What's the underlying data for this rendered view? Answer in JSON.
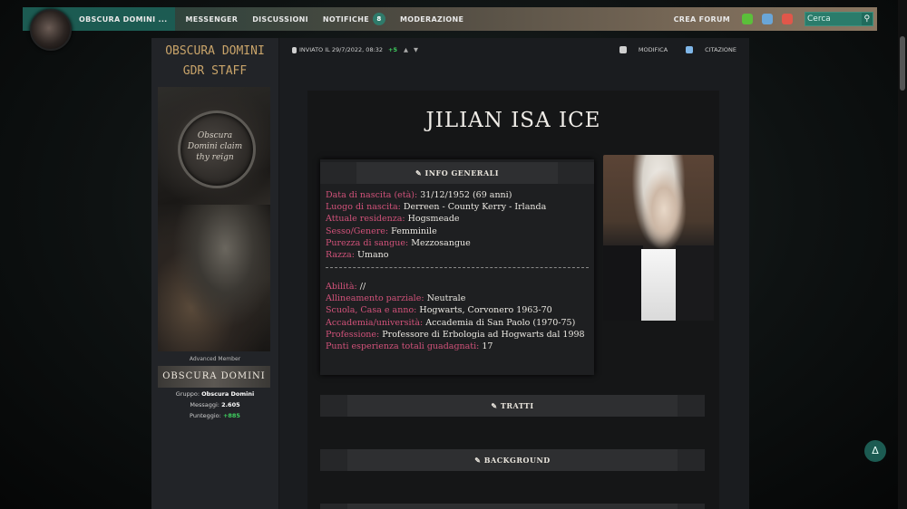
{
  "nav": {
    "brand": "OBSCURA DOMINI ...",
    "items": [
      "MESSENGER",
      "DISCUSSIONI",
      "NOTIFICHE",
      "MODERAZIONE"
    ],
    "notifications_count": "8",
    "crea_forum": "CREA FORUM",
    "search_placeholder": "Cerca"
  },
  "author": {
    "name_line1": "OBSCURA DOMINI",
    "name_line2": "GDR STAFF",
    "avatar_text": "Obscura Domini claim thy reign",
    "rank": "Advanced Member",
    "rank_banner": "OBSCURA DOMINI",
    "group_label": "Gruppo:",
    "group_value": "Obscura Domini",
    "messages_label": "Messaggi:",
    "messages_value": "2.605",
    "score_label": "Punteggio:",
    "score_value": "+885"
  },
  "post_header": {
    "sent": "INVIATO IL 29/7/2022, 08:32",
    "plus": "+5",
    "edit": "MODIFICA",
    "quote": "CITAZIONE"
  },
  "sheet": {
    "character_name": "JILIAN ISA ICE",
    "info_title": "INFO GENERALI",
    "fields_a": [
      {
        "k": "Data di nascita (età):",
        "v": "31/12/1952 (69 anni)"
      },
      {
        "k": "Luogo di nascita:",
        "v": "Derreen - County Kerry - Irlanda"
      },
      {
        "k": "Attuale residenza:",
        "v": "Hogsmeade"
      },
      {
        "k": "Sesso/Genere:",
        "v": "Femminile"
      },
      {
        "k": "Purezza di sangue:",
        "v": "Mezzosangue"
      },
      {
        "k": "Razza:",
        "v": "Umano"
      }
    ],
    "fields_b": [
      {
        "k": "Abilità:",
        "v": "//"
      },
      {
        "k": "Allineamento parziale:",
        "v": "Neutrale"
      },
      {
        "k": "Scuola, Casa e anno:",
        "v": "Hogwarts, Corvonero 1963-70"
      },
      {
        "k": "Accademia/università:",
        "v": "Accademia di San Paolo (1970-75)"
      },
      {
        "k": "Professione:",
        "v": "Professore di Erbologia ad Hogwarts dal 1998"
      },
      {
        "k": "Punti esperienza totali guadagnati:",
        "v": "17"
      }
    ],
    "tratti_title": "TRATTI",
    "background_title": "BACKGROUND"
  },
  "colors": {
    "field_key": "#d2527a",
    "name_gold": "#c9a46a",
    "brand_green": "#1c5b52"
  }
}
